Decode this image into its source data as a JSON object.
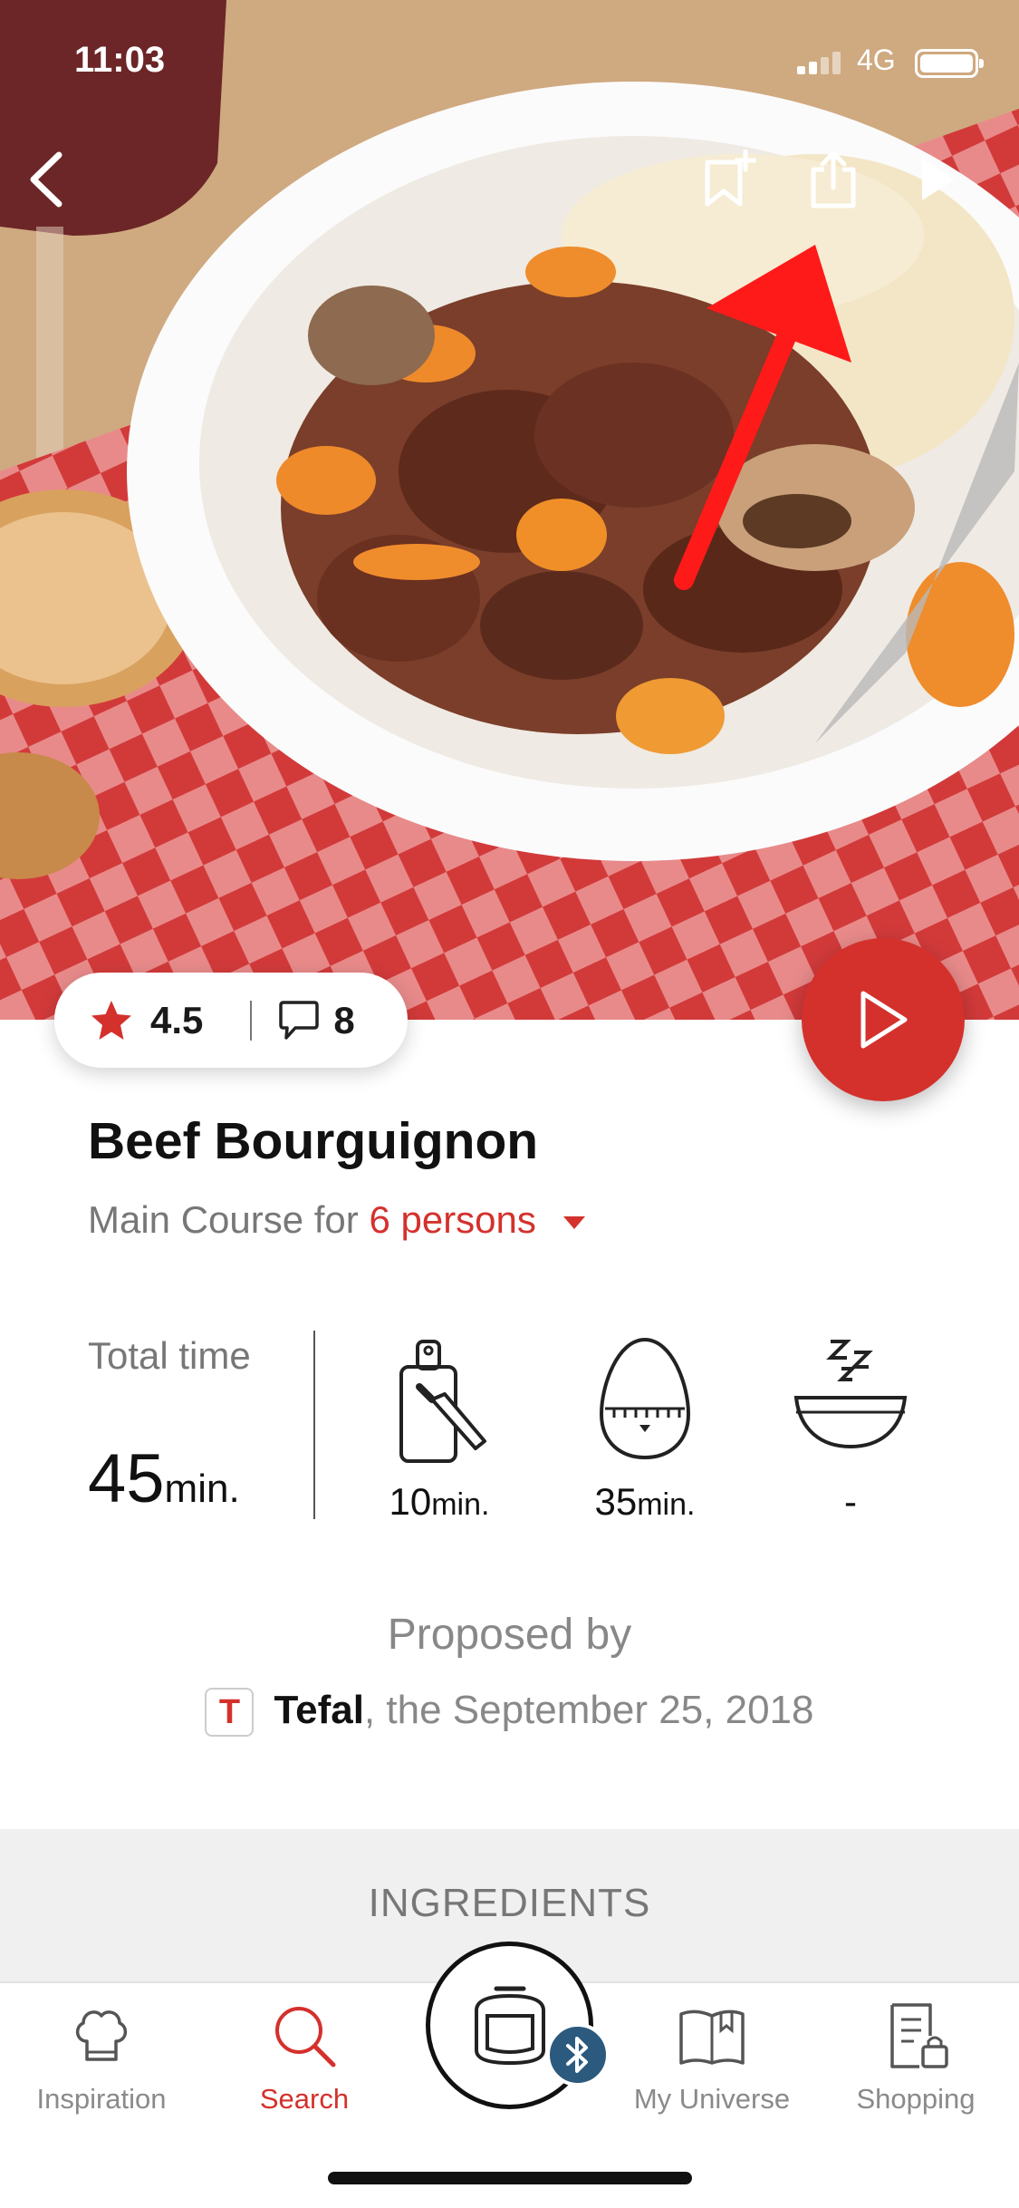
{
  "status_bar": {
    "time": "11:03",
    "network": "4G"
  },
  "recipe": {
    "title": "Beef Bourguignon",
    "course_prefix": "Main Course for",
    "persons": "6 persons",
    "rating": "4.5",
    "comments": "8"
  },
  "times": {
    "total_label": "Total time",
    "total_value": "45",
    "total_unit": "min.",
    "prep_value": "10",
    "prep_unit": "min.",
    "cook_value": "35",
    "cook_unit": "min.",
    "rest_value": "-"
  },
  "proposed": {
    "label": "Proposed by",
    "badge_letter": "T",
    "author": "Tefal",
    "date_text": ", the September 25, 2018"
  },
  "ingredients_label": "INGREDIENTS",
  "tabs": {
    "inspiration": "Inspiration",
    "search": "Search",
    "my_universe": "My Universe",
    "shopping": "Shopping"
  },
  "colors": {
    "accent": "#d4312c",
    "bluetooth": "#2b5a7e"
  },
  "icons": [
    "back-icon",
    "bookmark-add-icon",
    "share-icon",
    "play-icon",
    "star-icon",
    "comment-icon",
    "cutting-board-icon",
    "egg-timer-icon",
    "sleep-bowl-icon",
    "chef-hat-icon",
    "search-icon",
    "cooker-icon",
    "bluetooth-icon",
    "book-icon",
    "shopping-list-icon"
  ]
}
